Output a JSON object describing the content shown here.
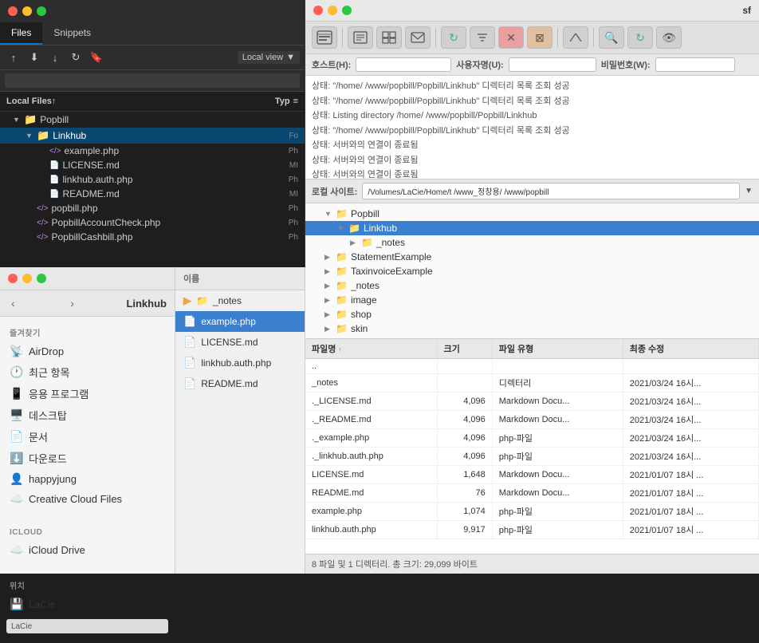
{
  "window": {
    "title": "sf"
  },
  "left_panel": {
    "tabs": [
      "Files",
      "Snippets"
    ],
    "active_tab": "Files",
    "toolbar_icons": [
      "upload",
      "download-folder",
      "download",
      "refresh",
      "bookmark"
    ],
    "local_view_label": "Local view",
    "search_placeholder": "",
    "file_header_label": "Local Files",
    "file_header_sort": "↑",
    "type_column": "Typ",
    "tree": [
      {
        "level": 1,
        "type": "folder",
        "name": "Popbill",
        "expanded": true,
        "type_label": ""
      },
      {
        "level": 2,
        "type": "folder",
        "name": "Linkhub",
        "expanded": true,
        "type_label": "Fo",
        "selected": true
      },
      {
        "level": 3,
        "type": "php",
        "name": "example.php",
        "type_label": "Ph"
      },
      {
        "level": 3,
        "type": "md",
        "name": "LICENSE.md",
        "type_label": "MI"
      },
      {
        "level": 3,
        "type": "php",
        "name": "linkhub.auth.php",
        "type_label": "Ph"
      },
      {
        "level": 3,
        "type": "md",
        "name": "README.md",
        "type_label": "MI"
      },
      {
        "level": 2,
        "type": "php",
        "name": "popbill.php",
        "type_label": "Ph"
      },
      {
        "level": 2,
        "type": "php",
        "name": "PopbillAccountCheck.php",
        "type_label": "Ph"
      },
      {
        "level": 2,
        "type": "php",
        "name": "PopbillCashbill.php",
        "type_label": "Ph"
      }
    ]
  },
  "bottom_left": {
    "title": "Linkhub",
    "favorites_label": "즐겨찾기",
    "sidebar_items": [
      {
        "icon": "📡",
        "name": "AirDrop"
      },
      {
        "icon": "🕐",
        "name": "최근 항목"
      },
      {
        "icon": "📱",
        "name": "응용 프로그램"
      },
      {
        "icon": "🖥️",
        "name": "데스크탑"
      },
      {
        "icon": "📄",
        "name": "문서"
      },
      {
        "icon": "⬇️",
        "name": "다운로드"
      },
      {
        "icon": "👤",
        "name": "happyjung"
      },
      {
        "icon": "☁️",
        "name": "Creative Cloud Files"
      }
    ],
    "icloud_label": "iCloud",
    "icloud_items": [
      {
        "icon": "☁️",
        "name": "iCloud Drive"
      }
    ],
    "location_label": "위치",
    "location_items": [
      {
        "icon": "💾",
        "name": "LaCie"
      }
    ]
  },
  "bottom_middle": {
    "header": "이름",
    "items": [
      {
        "type": "folder",
        "name": "_notes",
        "expanded": false
      },
      {
        "type": "php",
        "name": "example.php"
      },
      {
        "type": "md",
        "name": "LICENSE.md"
      },
      {
        "type": "php",
        "name": "linkhub.auth.php"
      },
      {
        "type": "md",
        "name": "README.md"
      }
    ]
  },
  "right_panel": {
    "title": "sf",
    "connection": {
      "host_label": "호스트(H):",
      "host_value": "",
      "user_label": "사용자명(U):",
      "user_value": "",
      "pass_label": "비밀번호(W):",
      "pass_value": ""
    },
    "log_lines": [
      "상태:  \"/home/       /www/popbill/Popbill/Linkhub\" 디렉터리 목록 조회 성공",
      "상태:  \"/home/       /www/popbill/Popbill/Linkhub\" 디렉터리 목록 조회 성공",
      "상태:  Listing directory /home/       /www/popbill/Popbill/Linkhub",
      "상태:  \"/home/       /www/popbill/Popbill/Linkhub\" 디렉터리 목록 조회 성공",
      "상태:  서버와의 연결이 종료됨",
      "상태:  서버와의 연결이 종료됨",
      "상태:  서버와의 연결이 종료됨"
    ],
    "local_site_label": "로컬 사이트:",
    "local_site_path": "/Volumes/LaCie/Home/t              /www_정창용/          /www/popbill",
    "remote_tree": [
      {
        "level": 0,
        "type": "folder",
        "name": "Popbill",
        "expanded": true,
        "arrow": "▼"
      },
      {
        "level": 1,
        "type": "folder",
        "name": "Linkhub",
        "expanded": true,
        "arrow": "▼",
        "selected": true
      },
      {
        "level": 2,
        "type": "folder",
        "name": "_notes",
        "expanded": false,
        "arrow": "▶"
      },
      {
        "level": 0,
        "type": "folder",
        "name": "StatementExample",
        "expanded": false,
        "arrow": "▶"
      },
      {
        "level": 0,
        "type": "folder",
        "name": "TaxinvoiceExample",
        "expanded": false,
        "arrow": "▶"
      },
      {
        "level": 0,
        "type": "folder",
        "name": "_notes",
        "expanded": false,
        "arrow": "▶"
      },
      {
        "level": 0,
        "type": "folder",
        "name": "image",
        "expanded": false,
        "arrow": "▶"
      },
      {
        "level": 0,
        "type": "folder",
        "name": "shop",
        "expanded": false,
        "arrow": "▶"
      },
      {
        "level": 0,
        "type": "folder",
        "name": "skin",
        "expanded": false,
        "arrow": "▶"
      }
    ],
    "file_table": {
      "columns": [
        {
          "label": "파일명",
          "sort": "↑"
        },
        {
          "label": "크기"
        },
        {
          "label": "파일 유형"
        },
        {
          "label": "최종 수정"
        }
      ],
      "rows": [
        {
          "name": "..",
          "size": "",
          "type": "",
          "modified": ""
        },
        {
          "name": "_notes",
          "size": "",
          "type": "디렉터리",
          "modified": "2021/03/24 16시..."
        },
        {
          "name": "._LICENSE.md",
          "size": "4,096",
          "type": "Markdown Docu...",
          "modified": "2021/03/24 16시..."
        },
        {
          "name": "._README.md",
          "size": "4,096",
          "type": "Markdown Docu...",
          "modified": "2021/03/24 16시..."
        },
        {
          "name": "._example.php",
          "size": "4,096",
          "type": "php-파일",
          "modified": "2021/03/24 16시..."
        },
        {
          "name": "._linkhub.auth.php",
          "size": "4,096",
          "type": "php-파일",
          "modified": "2021/03/24 16시..."
        },
        {
          "name": "LICENSE.md",
          "size": "1,648",
          "type": "Markdown Docu...",
          "modified": "2021/01/07 18시 ..."
        },
        {
          "name": "README.md",
          "size": "76",
          "type": "Markdown Docu...",
          "modified": "2021/01/07 18시 ..."
        },
        {
          "name": "example.php",
          "size": "1,074",
          "type": "php-파일",
          "modified": "2021/01/07 18시 ..."
        },
        {
          "name": "linkhub.auth.php",
          "size": "9,917",
          "type": "php-파일",
          "modified": "2021/01/07 18시 ..."
        }
      ]
    },
    "status_bar": "8 파일 및 1 디렉터리. 총 크기: 29,099 바이트"
  }
}
